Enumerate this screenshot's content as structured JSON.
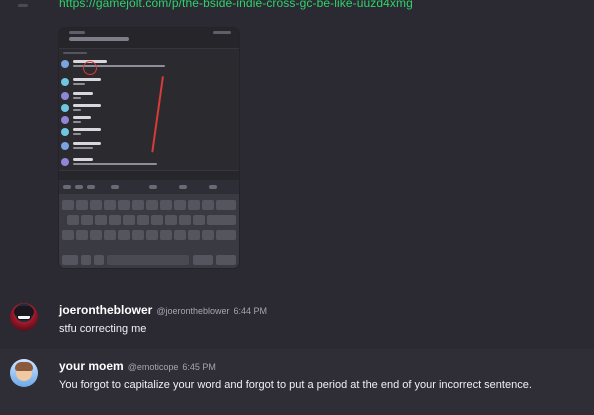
{
  "chat": {
    "link_text": "https://gamejolt.com/p/the-bside-indie-cross-gc-be-like-uuzd4xmg",
    "messages": [
      {
        "username": "joerontheblower",
        "handle": "@joerontheblower",
        "timestamp": "6:44 PM",
        "text": "stfu correcting me"
      },
      {
        "username": "your moem",
        "handle": "@emoticope",
        "timestamp": "6:45 PM",
        "text": "You forgot to capitalize your word and forgot to put a period at the end of your incorrect sentence."
      }
    ]
  },
  "colors": {
    "background": "#2b2a33",
    "link": "#2fd36b",
    "highlight_row": "#2f2e37",
    "annotation": "#d93a3a"
  },
  "icons": {
    "collapsed_indicator": "collapsed-message-indicator",
    "embedded_screenshot": "image-embed"
  }
}
